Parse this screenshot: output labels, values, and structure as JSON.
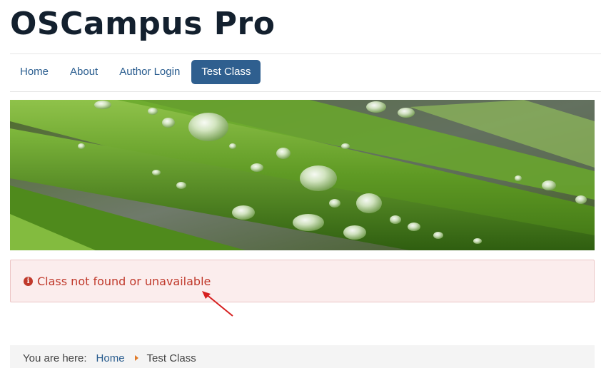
{
  "site": {
    "title": "OSCampus Pro"
  },
  "nav": {
    "items": [
      {
        "label": "Home",
        "active": false
      },
      {
        "label": "About",
        "active": false
      },
      {
        "label": "Author Login",
        "active": false
      },
      {
        "label": "Test Class",
        "active": true
      }
    ]
  },
  "banner": {
    "image": "grass-with-water-droplets"
  },
  "alert": {
    "icon": "info-circle-icon",
    "message": "Class not found or unavailable",
    "color": "#c0392b"
  },
  "breadcrumb": {
    "prefix": "You are here:",
    "items": [
      "Home",
      "Test Class"
    ]
  },
  "colors": {
    "nav_active": "#2f5f8f",
    "link": "#2a5d8f",
    "alert_bg": "#fbeded",
    "separator": "#e07b2a",
    "annotation": "#d61f1f"
  }
}
